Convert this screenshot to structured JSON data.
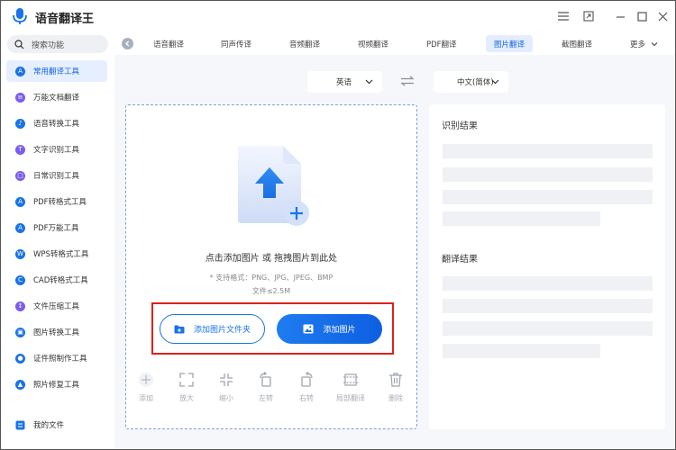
{
  "app": {
    "title": "语音翻译王"
  },
  "window_controls": [
    "menu",
    "restore-app",
    "minimize",
    "maximize",
    "close"
  ],
  "sidebar": {
    "search": {
      "label": "搜索功能"
    },
    "items": [
      {
        "label": "常用翻译工具",
        "icon": "translate-icon",
        "color": "#1a73e8",
        "active": true
      },
      {
        "label": "万能文档翻译",
        "icon": "document-icon",
        "color": "#7b5cf0"
      },
      {
        "label": "语音转换工具",
        "icon": "voice-icon",
        "color": "#1a73e8"
      },
      {
        "label": "文字识别工具",
        "icon": "text-scan-icon",
        "color": "#7b5cf0"
      },
      {
        "label": "日常识别工具",
        "icon": "scan-icon",
        "color": "#7b5cf0"
      },
      {
        "label": "PDF转格式工具",
        "icon": "pdf-icon",
        "color": "#1a73e8"
      },
      {
        "label": "PDF万能工具",
        "icon": "pdf-tool-icon",
        "color": "#1a73e8"
      },
      {
        "label": "WPS转格式工具",
        "icon": "wps-icon",
        "color": "#1a73e8"
      },
      {
        "label": "CAD转格式工具",
        "icon": "cad-icon",
        "color": "#1a73e8"
      },
      {
        "label": "文件压缩工具",
        "icon": "compress-icon",
        "color": "#7b5cf0"
      },
      {
        "label": "图片转换工具",
        "icon": "image-convert-icon",
        "color": "#1a73e8"
      },
      {
        "label": "证件照制作工具",
        "icon": "id-photo-icon",
        "color": "#1a73e8"
      },
      {
        "label": "照片修复工具",
        "icon": "photo-repair-icon",
        "color": "#1a73e8"
      }
    ],
    "my_files": "我的文件"
  },
  "tabs": [
    {
      "label": "语音翻译"
    },
    {
      "label": "同声传译"
    },
    {
      "label": "音频翻译"
    },
    {
      "label": "视频翻译"
    },
    {
      "label": "PDF翻译"
    },
    {
      "label": "图片翻译",
      "active": true
    },
    {
      "label": "截图翻译"
    },
    {
      "label": "更多"
    }
  ],
  "language": {
    "source": "英语",
    "target": "中文(简体)"
  },
  "upload": {
    "hint": "点击添加图片 或 拖拽图片到此处",
    "formats": "* 支持格式：PNG、JPG、JPEG、BMP",
    "size": "文件≤2.5M",
    "add_folder_label": "添加图片文件夹",
    "add_image_label": "添加图片"
  },
  "tools": [
    {
      "label": "添加",
      "icon": "plus-icon"
    },
    {
      "label": "放大",
      "icon": "expand-icon"
    },
    {
      "label": "缩小",
      "icon": "shrink-icon"
    },
    {
      "label": "左转",
      "icon": "rotate-left-icon"
    },
    {
      "label": "右转",
      "icon": "rotate-right-icon"
    },
    {
      "label": "局部翻译",
      "icon": "crop-icon"
    },
    {
      "label": "删除",
      "icon": "trash-icon"
    }
  ],
  "results": {
    "recognition_title": "识别结果",
    "translation_title": "翻译结果"
  },
  "colors": {
    "accent": "#1a73e8",
    "highlight_box": "#e02020"
  }
}
